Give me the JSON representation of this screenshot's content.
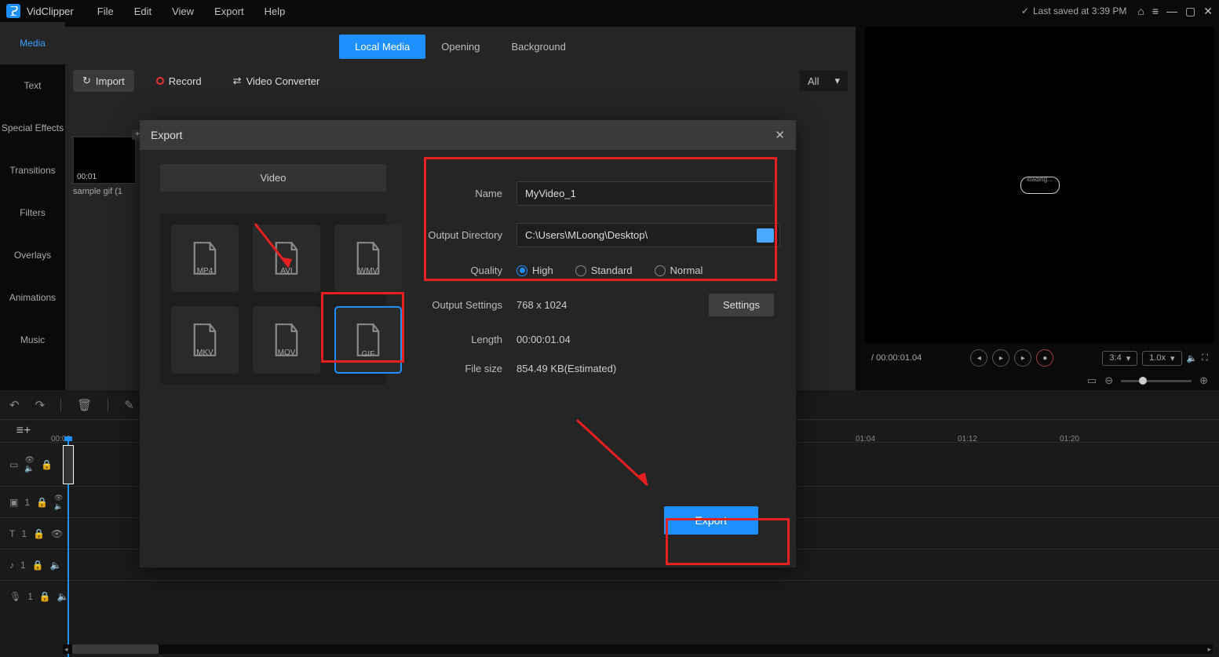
{
  "app": {
    "name": "VidClipper",
    "saved_text": "Last saved at 3:39 PM"
  },
  "menubar": [
    "File",
    "Edit",
    "View",
    "Export",
    "Help"
  ],
  "sidebar": [
    {
      "label": "Media",
      "active": true
    },
    {
      "label": "Text"
    },
    {
      "label": "Special Effects"
    },
    {
      "label": "Transitions"
    },
    {
      "label": "Filters"
    },
    {
      "label": "Overlays"
    },
    {
      "label": "Animations"
    },
    {
      "label": "Music"
    }
  ],
  "content_tabs": [
    {
      "label": "Local Media",
      "active": true
    },
    {
      "label": "Opening"
    },
    {
      "label": "Background"
    }
  ],
  "toolbar": {
    "import": "Import",
    "record": "Record",
    "converter": "Video Converter",
    "filter": "All"
  },
  "media_item": {
    "duration": "00:01",
    "name": "sample gif (1"
  },
  "preview": {
    "time_current": "",
    "time_total": "/ 00:00:01.04",
    "aspect": "3:4",
    "speed": "1.0x",
    "placeholder_text": "loading..."
  },
  "timeline": {
    "ruler_start": "00:00",
    "ticks": [
      "01:04",
      "01:12",
      "01:20"
    ],
    "tracks": [
      {
        "icon": "video",
        "tall": true
      },
      {
        "icon": "pip",
        "num": "1"
      },
      {
        "icon": "text",
        "num": "1"
      },
      {
        "icon": "audio",
        "num": "1"
      },
      {
        "icon": "mic",
        "num": "1"
      }
    ]
  },
  "export_dialog": {
    "title": "Export",
    "side_tab": "Video",
    "formats": [
      "MP4",
      "AVI",
      "WMV",
      "MKV",
      "MOV",
      "GIF"
    ],
    "selected_format": "GIF",
    "name_label": "Name",
    "name_value": "MyVideo_1",
    "dir_label": "Output Directory",
    "dir_value": "C:\\Users\\MLoong\\Desktop\\",
    "quality_label": "Quality",
    "quality_options": [
      "High",
      "Standard",
      "Normal"
    ],
    "quality_selected": "High",
    "settings_label": "Output Settings",
    "settings_value": "768 x 1024",
    "settings_btn": "Settings",
    "length_label": "Length",
    "length_value": "00:00:01.04",
    "size_label": "File size",
    "size_value": "854.49 KB(Estimated)",
    "export_btn": "Export"
  }
}
